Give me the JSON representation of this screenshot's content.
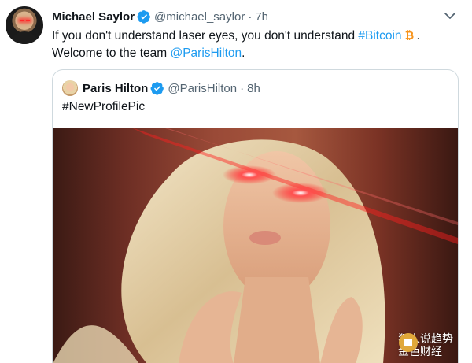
{
  "tweet": {
    "author_name": "Michael Saylor",
    "author_handle": "@michael_saylor",
    "separator": "·",
    "time": "7h",
    "text_part1": "If you don't understand laser eyes, you don't understand ",
    "hashtag": "#Bitcoin",
    "text_part2": ".",
    "text_line2_prefix": "Welcome to the team ",
    "mention": "@ParisHilton",
    "text_line2_suffix": "."
  },
  "quoted_tweet": {
    "author_name": "Paris Hilton",
    "author_handle": "@ParisHilton",
    "separator": "·",
    "time": "8h",
    "text": "#NewProfilePic"
  },
  "watermark": {
    "line1": "狂人说趋势",
    "line2": "金色财经"
  },
  "colors": {
    "link": "#1d9bf0",
    "verified": "#1d9bf0",
    "secondary_text": "#536471",
    "bitcoin": "#f7931a",
    "laser": "#ff1e1e"
  },
  "icons": [
    "verified-badge-icon",
    "bitcoin-icon",
    "more-caret-icon"
  ]
}
